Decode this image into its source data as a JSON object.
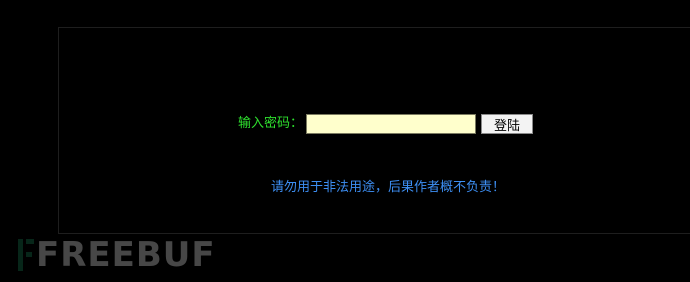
{
  "login": {
    "label": "输入密码：",
    "password_value": "",
    "button_label": "登陆"
  },
  "warning_text": "请勿用于非法用途，后果作者概不负责！",
  "watermark": {
    "text": "FREEBUF"
  },
  "colors": {
    "background": "#000000",
    "label": "#2ee02e",
    "input_background": "#ffffcc",
    "warning": "#3d8ef2"
  }
}
